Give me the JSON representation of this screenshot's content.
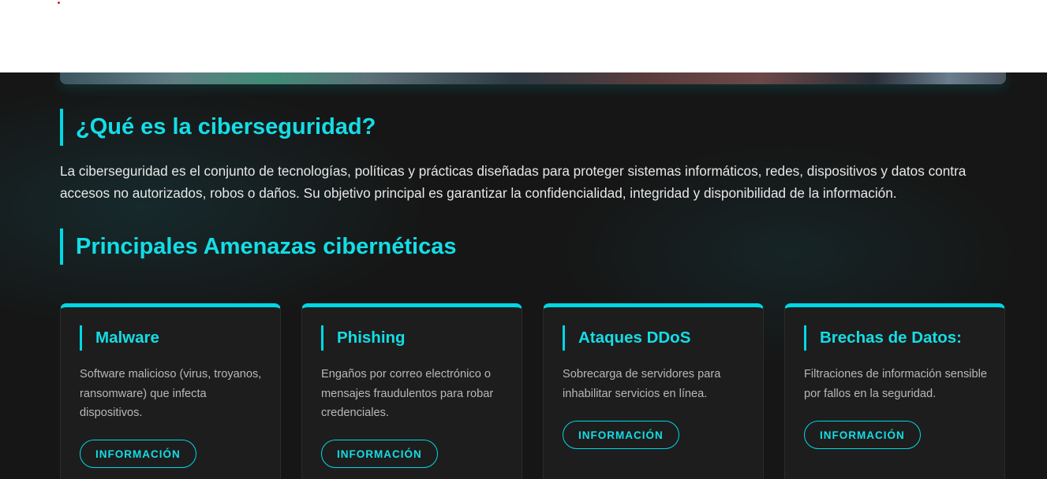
{
  "sections": {
    "intro_title": "¿Qué es la ciberseguridad?",
    "intro_text": "La ciberseguridad es el conjunto de tecnologías, políticas y prácticas diseñadas para proteger sistemas informáticos, redes, dispositivos y datos contra accesos no autorizados, robos o daños. Su objetivo principal es garantizar la confidencialidad, integridad y disponibilidad de la información.",
    "threats_title": "Principales Amenazas cibernéticas"
  },
  "cards": [
    {
      "title": "Malware",
      "text": "Software malicioso (virus, troyanos, ransomware) que infecta dispositivos.",
      "button": "INFORMACIÓN"
    },
    {
      "title": "Phishing",
      "text": "Engaños por correo electrónico o mensajes fraudulentos para robar credenciales.",
      "button": "INFORMACIÓN"
    },
    {
      "title": "Ataques DDoS",
      "text": "Sobrecarga de servidores para inhabilitar servicios en línea.",
      "button": "INFORMACIÓN"
    },
    {
      "title": "Brechas de Datos:",
      "text": "Filtraciones de información sensible por fallos en la seguridad.",
      "button": "INFORMACIÓN"
    }
  ],
  "colors": {
    "accent": "#00d8e6",
    "background": "#161616",
    "card_background": "#1d1d1d",
    "text": "#e8e8e8",
    "muted_text": "#b8b8b8"
  }
}
